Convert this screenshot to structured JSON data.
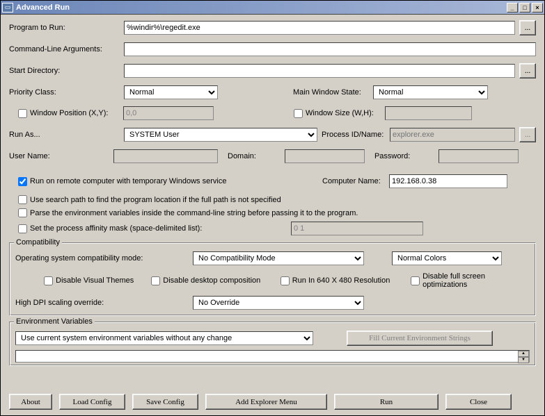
{
  "window": {
    "title": "Advanced Run"
  },
  "labels": {
    "program": "Program to Run:",
    "args": "Command-Line Arguments:",
    "startdir": "Start Directory:",
    "priority": "Priority Class:",
    "mainwin": "Main Window State:",
    "winpos": "Window Position (X,Y):",
    "winsize": "Window Size (W,H):",
    "runas": "Run As...",
    "procid": "Process ID/Name:",
    "username": "User Name:",
    "domain": "Domain:",
    "password": "Password:",
    "remote": "Run on remote computer with temporary Windows service",
    "compname": "Computer Name:",
    "searchpath": "Use search path to find the program location if the full path is not specified",
    "parseenv": "Parse the environment variables inside the command-line string before passing it to the program.",
    "affinity": "Set the process affinity mask (space-delimited list):",
    "compat_group": "Compatibility",
    "os_compat": "Operating system compatibility mode:",
    "disable_themes": "Disable Visual Themes",
    "disable_desktop": "Disable desktop composition",
    "run640": "Run In 640 X 480 Resolution",
    "disable_fullscreen": "Disable full screen optimizations",
    "hidpi": "High DPI scaling override:",
    "envvars_group": "Environment Variables",
    "fillenv": "Fill Current Environment Strings",
    "about": "About",
    "loadcfg": "Load Config",
    "savecfg": "Save Config",
    "addexplorer": "Add Explorer Menu",
    "run": "Run",
    "close": "Close",
    "browse": "..."
  },
  "values": {
    "program": "%windir%\\regedit.exe",
    "args": "",
    "startdir": "",
    "priority": "Normal",
    "mainwin": "Normal",
    "winpos": "0,0",
    "winsize": "",
    "runas": "SYSTEM User",
    "procid_placeholder": "explorer.exe",
    "username": "",
    "domain": "",
    "password": "",
    "compname": "192.168.0.38",
    "affinity": "0 1",
    "os_compat": "No Compatibility Mode",
    "colors": "Normal Colors",
    "hidpi": "No Override",
    "envmode": "Use current system environment variables without any change"
  },
  "checked": {
    "winpos": false,
    "winsize": false,
    "remote": true,
    "searchpath": false,
    "parseenv": false,
    "affinity": false,
    "disable_themes": false,
    "disable_desktop": false,
    "run640": false,
    "disable_fullscreen": false
  }
}
